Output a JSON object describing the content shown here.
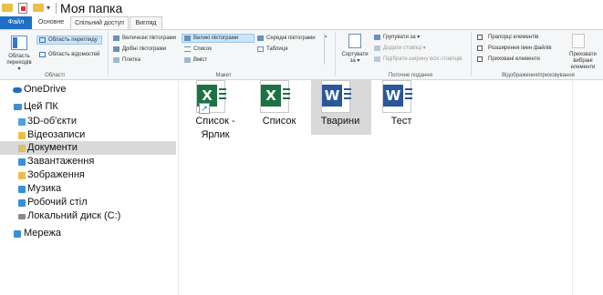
{
  "window": {
    "title": "Моя папка"
  },
  "tabs": [
    {
      "label": "Файл"
    },
    {
      "label": "Основне"
    },
    {
      "label": "Спільний доступ"
    },
    {
      "label": "Вигляд"
    }
  ],
  "ribbon": {
    "panes": {
      "nav_pane_label": "Область переходів",
      "preview_pane_label": "Область перегляду",
      "details_pane_label": "Область відомостей",
      "group_label": "Області"
    },
    "layout": {
      "options": [
        "Величезні піктограми",
        "Великі піктограми",
        "Середні піктограми",
        "Дрібні піктограми",
        "Список",
        "Таблиця",
        "Плитка",
        "Вміст"
      ],
      "selected": "Великі піктограми",
      "group_label": "Макет"
    },
    "current_view": {
      "sort_label": "Сортувати за",
      "group_by": "Групувати за",
      "add_columns": "Додати стовпці",
      "fit_columns": "Підібрати ширину всіх стовпців",
      "group_label": "Поточне подання"
    },
    "show_hide": {
      "item_checkboxes": "Прапорці елементів",
      "file_extensions": "Розширення імен файлів",
      "hidden_items": "Приховані елементи",
      "hide_selected": "Приховати вибрані елементи",
      "group_label": "Відображення/приховування"
    }
  },
  "nav": {
    "items": [
      {
        "label": "OneDrive",
        "icon": "cloud-icon"
      },
      {
        "label": "Цей ПК",
        "icon": "computer-icon"
      },
      {
        "label": "3D-об'єкти",
        "icon": "folder-icon"
      },
      {
        "label": "Відеозаписи",
        "icon": "folder-icon"
      },
      {
        "label": "Документи",
        "icon": "folder-icon",
        "selected": true
      },
      {
        "label": "Завантаження",
        "icon": "download-icon"
      },
      {
        "label": "Зображення",
        "icon": "folder-icon"
      },
      {
        "label": "Музика",
        "icon": "music-icon"
      },
      {
        "label": "Робочий стіл",
        "icon": "folder-icon"
      },
      {
        "label": "Локальний диск (C:)",
        "icon": "drive-icon"
      },
      {
        "label": "Мережа",
        "icon": "network-icon"
      }
    ]
  },
  "files": [
    {
      "name": "Список - Ярлик",
      "type": "excel-shortcut"
    },
    {
      "name": "Список",
      "type": "excel"
    },
    {
      "name": "Тварини",
      "type": "word",
      "selected": true
    },
    {
      "name": "Тест",
      "type": "word"
    }
  ],
  "colors": {
    "accent": "#1f6fc5",
    "excel": "#1e7145",
    "word": "#2b579a",
    "selection": "#d9d9d9",
    "ribbon_bg": "#f5f6f7"
  }
}
